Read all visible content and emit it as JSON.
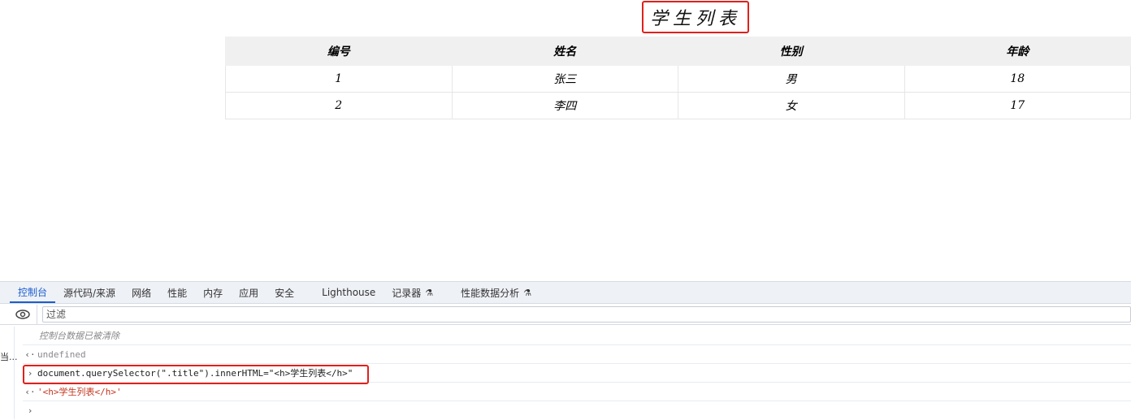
{
  "page": {
    "title": "学生列表",
    "table": {
      "headers": [
        "编号",
        "姓名",
        "性别",
        "年龄"
      ],
      "rows": [
        [
          "1",
          "张三",
          "男",
          "18"
        ],
        [
          "2",
          "李四",
          "女",
          "17"
        ]
      ]
    }
  },
  "devtools": {
    "tabs": [
      "控制台",
      "源代码/来源",
      "网络",
      "性能",
      "内存",
      "应用",
      "安全",
      "Lighthouse",
      "记录器",
      "性能数据分析"
    ],
    "active_tab": "控制台",
    "filter_placeholder": "过滤",
    "sidebar_cut_text": "当...",
    "console": {
      "cleared": "控制台数据已被清除",
      "undefined": "undefined",
      "command": "document.querySelector(\".title\").innerHTML=\"<h>学生列表</h>\"",
      "result": "'<h>学生列表</h>'"
    }
  },
  "colors": {
    "highlight": "#e0201b",
    "accent": "#1a5fd0",
    "table_header_bg": "#f0f0f0"
  }
}
